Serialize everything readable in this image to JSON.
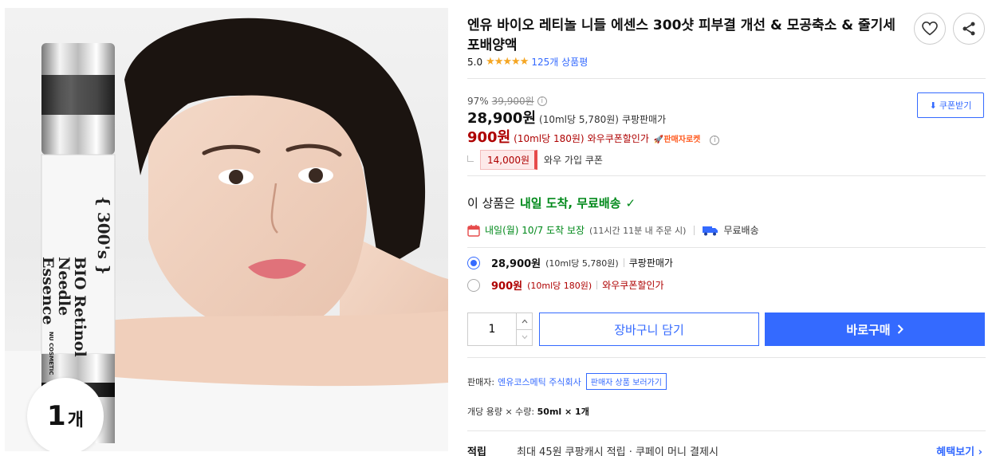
{
  "image": {
    "badge_count": "1",
    "badge_unit": "개",
    "bottle_label": {
      "line1": "BIO Retinol",
      "line2": "Needle",
      "line3": "Essence",
      "brand_mark": "{ 300's }",
      "maker": "NU COSMETIC"
    }
  },
  "product": {
    "title": "엔유 바이오 레티놀 니들 에센스 300샷 피부결 개선 & 모공축소 & 줄기세포배양액",
    "rating": "5.0",
    "reviews": "125개 상품평",
    "wishlist_icon": "heart-icon",
    "share_icon": "share-icon"
  },
  "price": {
    "discount_rate": "97%",
    "original": "39,900원",
    "sale": "28,900원",
    "sale_unit": "(10ml당 5,780원)",
    "sale_label": "쿠팡판매가",
    "wow": "900원",
    "wow_unit": "(10ml당 180원)",
    "wow_label": "와우쿠폰할인가",
    "rocket_label": "판매자로켓",
    "coupon_amount": "14,000원",
    "coupon_label": "와우 가입 쿠폰",
    "coupon_button": "쿠폰받기"
  },
  "delivery": {
    "head_prefix": "이 상품은",
    "head_em": "내일 도착, 무료배송",
    "date_text": "내일(월) 10/7 도착 보장",
    "date_sub": "(11시간 11분 내 주문 시)",
    "free_shipping": "무료배송"
  },
  "options": [
    {
      "price": "28,900원",
      "unit": "(10ml당 5,780원)",
      "label": "쿠팡판매가",
      "selected": true
    },
    {
      "price": "900원",
      "unit": "(10ml당 180원)",
      "label": "와우쿠폰할인가",
      "selected": false
    }
  ],
  "purchase": {
    "quantity": "1",
    "cart_button": "장바구니 담기",
    "buy_button": "바로구매"
  },
  "seller": {
    "prefix": "판매자:",
    "name": "엔유코스메틱 주식회사",
    "more_button": "판매자 상품 보러가기"
  },
  "option_line": {
    "text": "개당 용량 × 수량:",
    "value": "50ml × 1개"
  },
  "reward": {
    "label": "적립",
    "text": "최대 45원 쿠팡캐시 적립 · 쿠페이 머니 결제시",
    "more": "혜택보기"
  },
  "colors": {
    "accent": "#346aff",
    "wow_red": "#ae0000",
    "delivery_green": "#00891a",
    "star": "#f5a623"
  }
}
